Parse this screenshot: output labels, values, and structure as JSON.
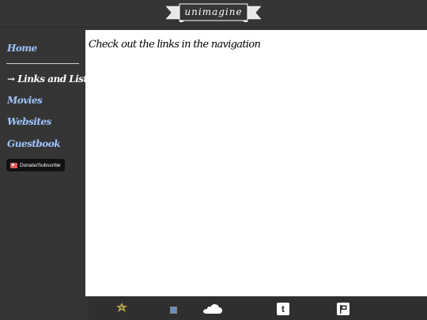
{
  "header": {
    "logo_text": "unimagine"
  },
  "sidebar": {
    "items": [
      {
        "label": "Home",
        "active": false
      },
      {
        "label": "→ Links and Lists",
        "active": true
      },
      {
        "label": "Movies",
        "active": false
      },
      {
        "label": "Websites",
        "active": false
      },
      {
        "label": "Guestbook",
        "active": false
      }
    ],
    "donate_label": "Donate/Subscribe"
  },
  "main": {
    "message": "Check out the links in the navigation"
  },
  "footer": {
    "icons": [
      "game-badge-icon",
      "broken-image-icon",
      "soundcloud-icon",
      "tumblr-icon",
      "flag-icon"
    ],
    "tumblr_glyph": "t"
  },
  "colors": {
    "background": "#353535",
    "content": "#ffffff",
    "link": "#9ec3ff",
    "active_link": "#ffffff"
  }
}
